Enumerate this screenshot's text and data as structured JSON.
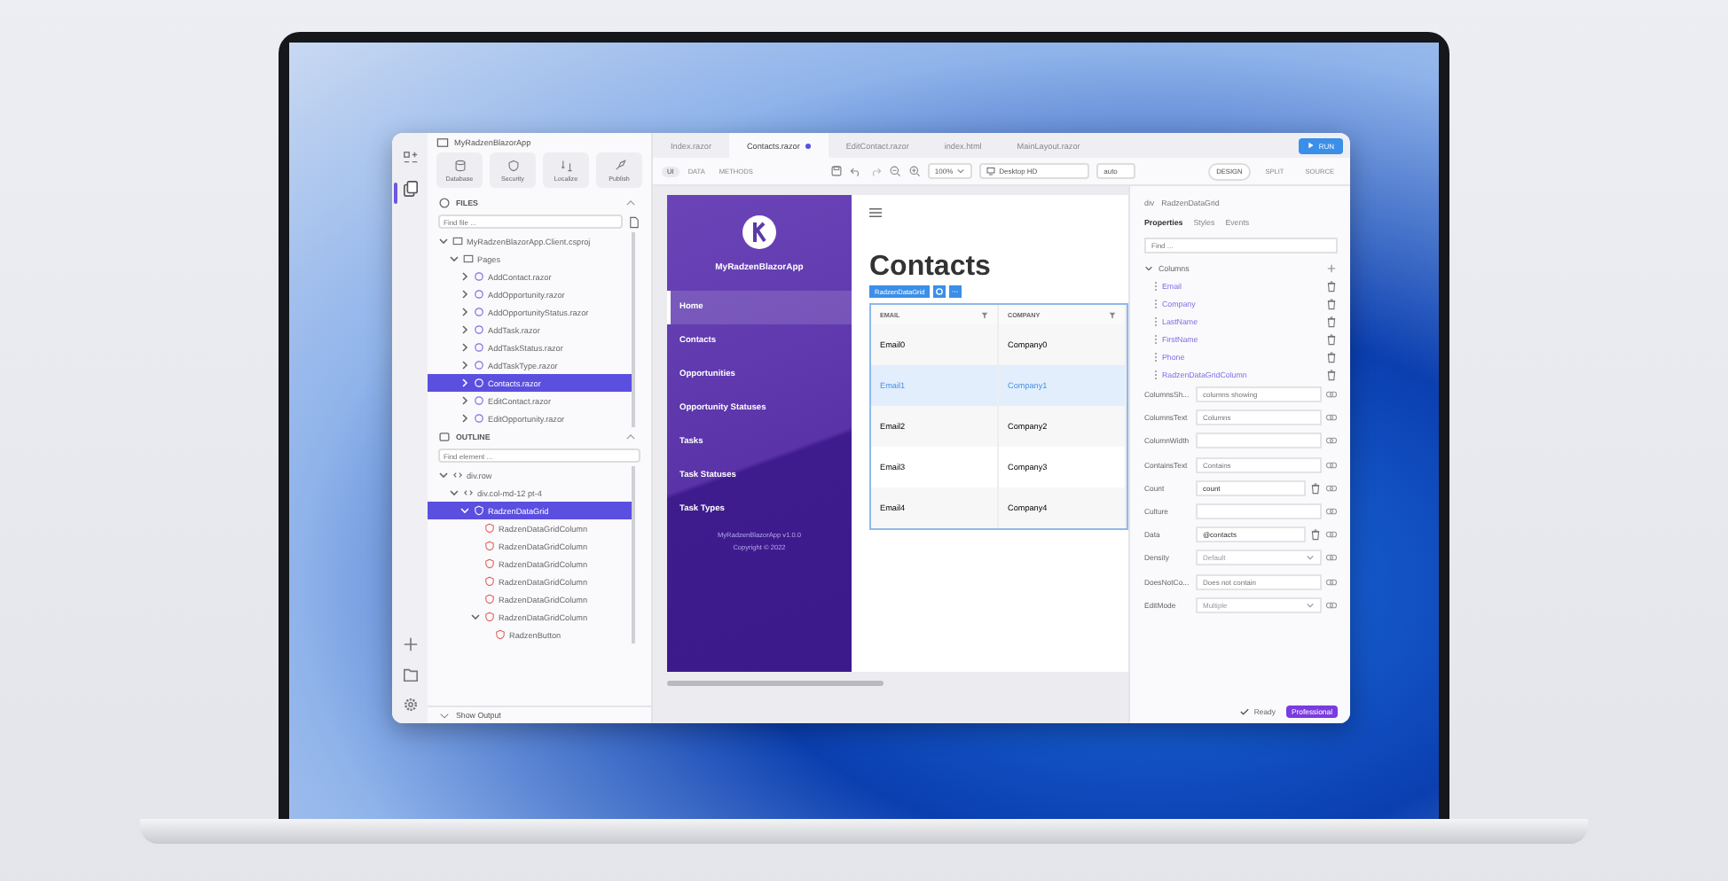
{
  "project": "MyRadzenBlazorApp",
  "toolbar": [
    {
      "label": "Database"
    },
    {
      "label": "Security"
    },
    {
      "label": "Localize"
    },
    {
      "label": "Publish"
    }
  ],
  "files": {
    "title": "FILES",
    "placeholder": "Find file ...",
    "tree": [
      {
        "label": "MyRadzenBlazorApp.Client.csproj",
        "kind": "folder",
        "expanded": true,
        "selected": false,
        "children": [
          {
            "label": "Pages",
            "kind": "folder",
            "expanded": true,
            "selected": false,
            "children": [
              {
                "label": "AddContact.razor",
                "kind": "file",
                "expanded": false,
                "selected": false
              },
              {
                "label": "AddOpportunity.razor",
                "kind": "file",
                "expanded": false,
                "selected": false
              },
              {
                "label": "AddOpportunityStatus.razor",
                "kind": "file",
                "expanded": false,
                "selected": false
              },
              {
                "label": "AddTask.razor",
                "kind": "file",
                "expanded": false,
                "selected": false
              },
              {
                "label": "AddTaskStatus.razor",
                "kind": "file",
                "expanded": false,
                "selected": false
              },
              {
                "label": "AddTaskType.razor",
                "kind": "file",
                "expanded": false,
                "selected": false
              },
              {
                "label": "Contacts.razor",
                "kind": "file",
                "expanded": false,
                "selected": true
              },
              {
                "label": "EditContact.razor",
                "kind": "file",
                "expanded": false,
                "selected": false
              },
              {
                "label": "EditOpportunity.razor",
                "kind": "file",
                "expanded": false,
                "selected": false
              }
            ]
          }
        ]
      }
    ]
  },
  "outline": {
    "title": "OUTLINE",
    "placeholder": "Find element ...",
    "tree": [
      {
        "label": "div.row",
        "kind": "tag",
        "expanded": true,
        "selected": false,
        "children": [
          {
            "label": "div.col-md-12 pt-4",
            "kind": "tag",
            "expanded": true,
            "selected": false,
            "children": [
              {
                "label": "RadzenDataGrid",
                "kind": "component",
                "expanded": true,
                "selected": true,
                "children": [
                  {
                    "label": "RadzenDataGridColumn",
                    "kind": "component",
                    "selected": false
                  },
                  {
                    "label": "RadzenDataGridColumn",
                    "kind": "component",
                    "selected": false
                  },
                  {
                    "label": "RadzenDataGridColumn",
                    "kind": "component",
                    "selected": false
                  },
                  {
                    "label": "RadzenDataGridColumn",
                    "kind": "component",
                    "selected": false
                  },
                  {
                    "label": "RadzenDataGridColumn",
                    "kind": "component",
                    "selected": false
                  },
                  {
                    "label": "RadzenDataGridColumn",
                    "kind": "component",
                    "expanded": true,
                    "selected": false,
                    "children": [
                      {
                        "label": "RadzenButton",
                        "kind": "component",
                        "selected": false
                      }
                    ]
                  }
                ]
              }
            ]
          }
        ]
      }
    ]
  },
  "show_output": "Show Output",
  "tabs": [
    {
      "label": "Index.razor",
      "selected": false,
      "modified": false
    },
    {
      "label": "Contacts.razor",
      "selected": true,
      "modified": true
    },
    {
      "label": "EditContact.razor",
      "selected": false,
      "modified": false
    },
    {
      "label": "index.html",
      "selected": false,
      "modified": false
    },
    {
      "label": "MainLayout.razor",
      "selected": false,
      "modified": false
    }
  ],
  "run": "RUN",
  "modes": [
    {
      "label": "UI",
      "selected": true
    },
    {
      "label": "DATA",
      "selected": false
    },
    {
      "label": "METHODS",
      "selected": false
    }
  ],
  "zoom": "100%",
  "device": "Desktop HD",
  "size": "auto",
  "views": [
    {
      "label": "DESIGN",
      "selected": true
    },
    {
      "label": "SPLIT",
      "selected": false
    },
    {
      "label": "SOURCE",
      "selected": false
    }
  ],
  "preview": {
    "app_name": "MyRadzenBlazorApp",
    "nav": [
      {
        "label": "Home",
        "selected": true
      },
      {
        "label": "Contacts",
        "selected": false
      },
      {
        "label": "Opportunities",
        "selected": false
      },
      {
        "label": "Opportunity Statuses",
        "selected": false
      },
      {
        "label": "Tasks",
        "selected": false
      },
      {
        "label": "Task Statuses",
        "selected": false
      },
      {
        "label": "Task Types",
        "selected": false
      }
    ],
    "footer": [
      "MyRadzenBlazorApp v1.0.0",
      "Copyright © 2022"
    ],
    "heading": "Contacts",
    "component": "RadzenDataGrid",
    "columns": [
      "EMAIL",
      "COMPANY"
    ],
    "rows": [
      {
        "cells": [
          "Email0",
          "Company0"
        ],
        "selected": false
      },
      {
        "cells": [
          "Email1",
          "Company1"
        ],
        "selected": true
      },
      {
        "cells": [
          "Email2",
          "Company2"
        ],
        "selected": false
      },
      {
        "cells": [
          "Email3",
          "Company3"
        ],
        "selected": false
      },
      {
        "cells": [
          "Email4",
          "Company4"
        ],
        "selected": false
      }
    ]
  },
  "properties": {
    "breadcrumb": [
      "div",
      "RadzenDataGrid"
    ],
    "tabs": [
      {
        "label": "Properties",
        "selected": true
      },
      {
        "label": "Styles",
        "selected": false
      },
      {
        "label": "Events",
        "selected": false
      }
    ],
    "placeholder": "Find ...",
    "columns_label": "Columns",
    "columns": [
      "Email",
      "Company",
      "LastName",
      "FirstName",
      "Phone",
      "RadzenDataGridColumn"
    ],
    "fields": [
      {
        "label": "ColumnsSh...",
        "kind": "text",
        "placeholder": "columns showing"
      },
      {
        "label": "ColumnsText",
        "kind": "text",
        "placeholder": "Columns"
      },
      {
        "label": "ColumnWidth",
        "kind": "text"
      },
      {
        "label": "ContainsText",
        "kind": "text",
        "placeholder": "Contains"
      },
      {
        "label": "Count",
        "kind": "text",
        "value": "count",
        "clearable": true
      },
      {
        "label": "Culture",
        "kind": "text"
      },
      {
        "label": "Data",
        "kind": "text",
        "value": "@contacts",
        "clearable": true
      },
      {
        "label": "Density",
        "kind": "select",
        "value": "Default"
      },
      {
        "label": "DoesNotCo...",
        "kind": "text",
        "placeholder": "Does not contain"
      },
      {
        "label": "EditMode",
        "kind": "select",
        "value": "Multiple"
      }
    ]
  },
  "status": "Ready",
  "edition": "Professional"
}
